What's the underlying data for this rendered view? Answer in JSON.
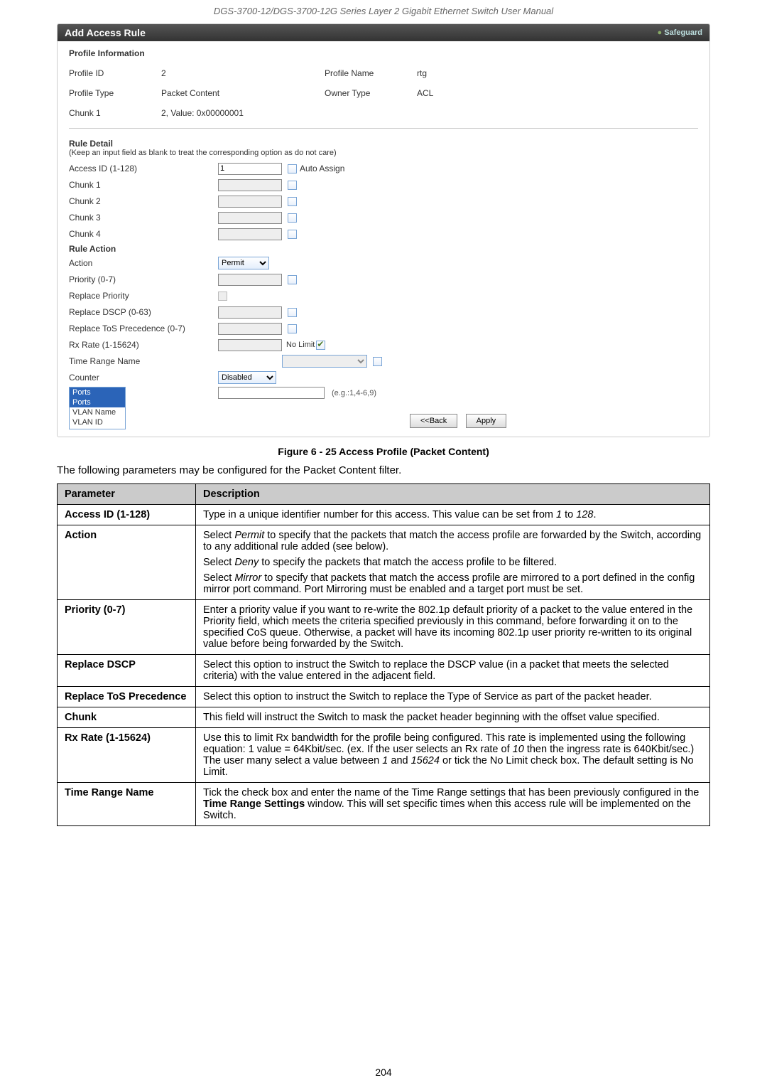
{
  "header": "DGS-3700-12/DGS-3700-12G Series Layer 2 Gigabit Ethernet Switch User Manual",
  "panel": {
    "title": "Add Access Rule",
    "safeguard": "Safeguard",
    "profile_info_title": "Profile Information",
    "profile_id_lbl": "Profile ID",
    "profile_id_val": "2",
    "profile_name_lbl": "Profile Name",
    "profile_name_val": "rtg",
    "profile_type_lbl": "Profile Type",
    "profile_type_val": "Packet Content",
    "owner_type_lbl": "Owner Type",
    "owner_type_val": "ACL",
    "chunk1_lbl": "Chunk 1",
    "chunk1_val": "2, Value: 0x00000001",
    "rule_detail_title": "Rule Detail",
    "rule_caption": "(Keep an input field as blank to treat the corresponding option as do not care)",
    "access_id_lbl": "Access ID (1-128)",
    "access_id_val": "1",
    "auto_assign": "Auto Assign",
    "chunk_r1": "Chunk 1",
    "chunk_r2": "Chunk 2",
    "chunk_r3": "Chunk 3",
    "chunk_r4": "Chunk 4",
    "rule_action_title": "Rule Action",
    "action_lbl": "Action",
    "action_val": "Permit",
    "priority_lbl": "Priority (0-7)",
    "replace_priority_lbl": "Replace Priority",
    "replace_dscp_lbl": "Replace DSCP (0-63)",
    "replace_tos_lbl": "Replace ToS Precedence (0-7)",
    "rx_rate_lbl": "Rx Rate (1-15624)",
    "no_limit": "No Limit",
    "time_range_lbl": "Time Range Name",
    "counter_lbl": "Counter",
    "counter_val": "Disabled",
    "eg": "(e.g.:1,4-6,9)",
    "btn_back": "<<Back",
    "btn_apply": "Apply",
    "dropdown": {
      "ports": "Ports",
      "ports2": "Ports",
      "vlan_name": "VLAN Name",
      "vlan_id": "VLAN ID"
    }
  },
  "figure_caption": "Figure 6 - 25 Access Profile (Packet Content)",
  "intro": "The following parameters may be configured for the Packet Content filter.",
  "table": {
    "h1": "Parameter",
    "h2": "Description",
    "rows": [
      {
        "param": "Access ID (1-128)",
        "paras": [
          "Type in a unique identifier number for this access. This value can be set from <i>1</i> to <i>128</i>."
        ]
      },
      {
        "param": "Action",
        "paras": [
          "Select <i>Permit</i> to specify that the packets that match the access profile are forwarded by the Switch, according to any additional rule added (see below).",
          "Select <i>Deny</i> to specify the packets that match the access profile to be filtered.",
          "Select <i>Mirror</i> to specify that packets that match the access profile are mirrored to a port defined in the config mirror port command. Port Mirroring must be enabled and a target port must be set."
        ]
      },
      {
        "param": "Priority (0-7)",
        "paras": [
          "Enter a priority value if you want to re-write the 802.1p default priority of a packet to the value entered in the Priority field, which meets the criteria specified previously in this command, before forwarding it on to the specified CoS queue. Otherwise, a packet will have its incoming 802.1p user priority re-written to its original value before being forwarded by the Switch."
        ]
      },
      {
        "param": "Replace DSCP",
        "paras": [
          "Select this option to instruct the Switch to replace the DSCP value (in a packet that meets the selected criteria) with the value entered in the adjacent field."
        ]
      },
      {
        "param": "Replace ToS Precedence",
        "paras": [
          "Select this option to instruct the Switch to replace the Type of Service as part of the packet header."
        ]
      },
      {
        "param": "Chunk",
        "paras": [
          "This field will instruct the Switch to mask the packet header beginning with the offset value specified."
        ]
      },
      {
        "param": "Rx Rate (1-15624)",
        "paras": [
          "Use this to limit Rx bandwidth for the profile being configured. This rate is implemented using the following equation: 1 value = 64Kbit/sec. (ex. If the user selects an Rx rate of <i>10</i> then the ingress rate is 640Kbit/sec.) The user many select a value between <i>1</i> and <i>15624</i> or tick the No Limit check box. The default setting is No Limit."
        ]
      },
      {
        "param": "Time Range Name",
        "paras": [
          "Tick the check box and enter the name of the Time Range settings that has been previously configured in the <b>Time Range Settings</b> window. This will set specific times when this access rule will be implemented on the Switch."
        ]
      }
    ]
  },
  "page_number": "204"
}
